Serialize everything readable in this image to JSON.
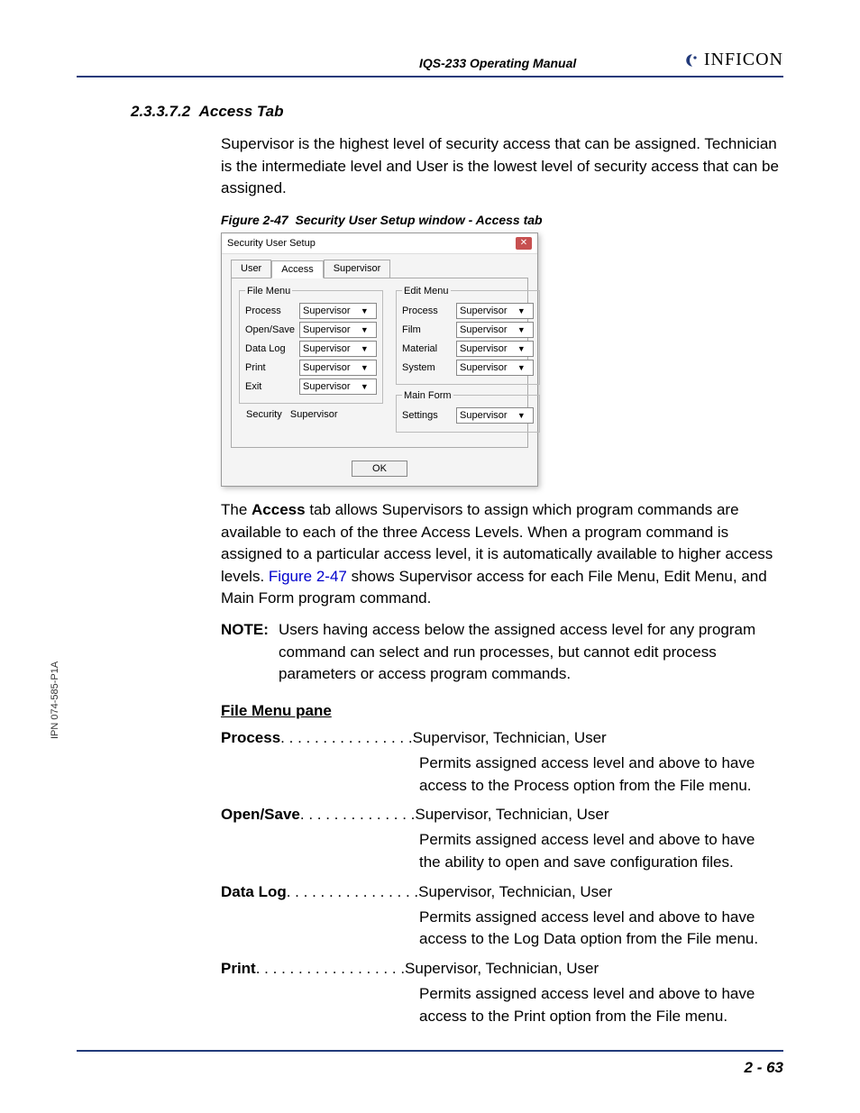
{
  "header": {
    "running_head": "IQS-233 Operating Manual",
    "brand": "INFICON"
  },
  "section": {
    "number": "2.3.3.7.2",
    "title": "Access Tab"
  },
  "intro_paragraph": "Supervisor is the highest level of security access that can be assigned. Technician is the intermediate level and User is the lowest level of security access that can be assigned.",
  "figure": {
    "label": "Figure 2-47",
    "caption": "Security User Setup window - Access tab"
  },
  "window": {
    "title": "Security User Setup",
    "close_glyph": "✕",
    "tabs": [
      "User",
      "Access",
      "Supervisor"
    ],
    "active_tab": "Access",
    "file_menu_legend": "File Menu",
    "edit_menu_legend": "Edit Menu",
    "main_form_legend": "Main Form",
    "file_menu": [
      {
        "label": "Process",
        "value": "Supervisor"
      },
      {
        "label": "Open/Save",
        "value": "Supervisor"
      },
      {
        "label": "Data Log",
        "value": "Supervisor"
      },
      {
        "label": "Print",
        "value": "Supervisor"
      },
      {
        "label": "Exit",
        "value": "Supervisor"
      }
    ],
    "edit_menu": [
      {
        "label": "Process",
        "value": "Supervisor"
      },
      {
        "label": "Film",
        "value": "Supervisor"
      },
      {
        "label": "Material",
        "value": "Supervisor"
      },
      {
        "label": "System",
        "value": "Supervisor"
      }
    ],
    "main_form": [
      {
        "label": "Settings",
        "value": "Supervisor"
      }
    ],
    "security_label": "Security",
    "security_value": "Supervisor",
    "ok_label": "OK"
  },
  "para2_prefix": "The ",
  "para2_bold": "Access",
  "para2_mid": " tab allows Supervisors to assign which program commands are available to each of the three Access Levels. When a program command is assigned to a particular access level, it is automatically available to higher access levels. ",
  "para2_link": "Figure 2-47",
  "para2_suffix": " shows Supervisor access for each File Menu, Edit Menu, and Main Form program command.",
  "note_label": "NOTE:",
  "note_body": "Users having access below the assigned access level for any program command can select and run processes, but cannot edit process parameters or access program commands.",
  "pane_title": "File Menu pane",
  "definitions": [
    {
      "term": "Process",
      "dots": " . . . . . . . . . . . . . . . . ",
      "value": "Supervisor, Technician, User",
      "desc": "Permits assigned access level and above to have access to the Process option from the File menu."
    },
    {
      "term": "Open/Save",
      "dots": ". . . . . . . . . . . . . . ",
      "value": "Supervisor, Technician, User",
      "desc": "Permits assigned access level and above to have the ability to open and save configuration files."
    },
    {
      "term": "Data Log",
      "dots": "  . . . . . . . . . . . . . . . . ",
      "value": "Supervisor, Technician, User",
      "desc": "Permits assigned access level and above to have access to the Log Data option from the File menu."
    },
    {
      "term": "Print",
      "dots": "   . . . . . . . . . . . . . . . . . . ",
      "value": "Supervisor, Technician, User",
      "desc": "Permits assigned access level and above to have access to the Print option from the File menu."
    }
  ],
  "side_ipn": "IPN 074-585-P1A",
  "page_number": "2 - 63"
}
